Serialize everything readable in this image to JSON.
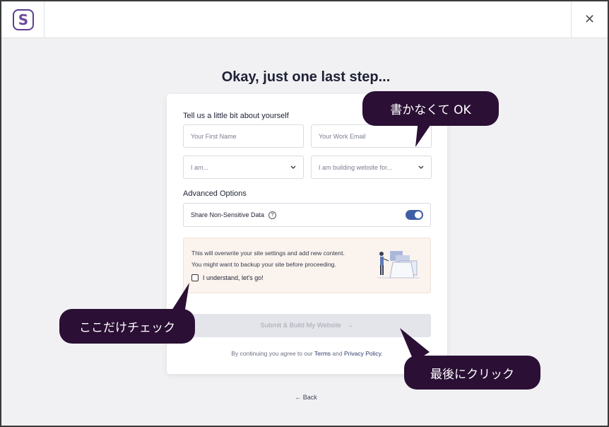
{
  "app": {
    "logo_letter": "S",
    "close_symbol": "✕"
  },
  "page": {
    "heading": "Okay, just one last step..."
  },
  "form": {
    "section_title": "Tell us a little bit about yourself",
    "first_name_placeholder": "Your First Name",
    "email_placeholder": "Your Work Email",
    "role_select": "I am...",
    "purpose_select": "I am building website for...",
    "advanced_title": "Advanced Options",
    "share_label": "Share Non-Sensitive Data",
    "share_help": "?",
    "share_enabled": true
  },
  "notice": {
    "line1": "This will overwrite your site settings and add new content.",
    "line2": "You might want to backup your site before proceeding.",
    "checkbox_label": "I understand, let's go!",
    "checked": false
  },
  "submit": {
    "label": "Submit & Build My Website",
    "arrow": "→"
  },
  "terms": {
    "prefix": "By continuing you agree to our",
    "terms_link": "Terms",
    "and": "and",
    "privacy_link": "Privacy Policy",
    "suffix": "."
  },
  "back": {
    "arrow": "←",
    "label": "Back"
  },
  "annotations": {
    "no_need_to_write": "書かなくて OK",
    "check_only_here": "ここだけチェック",
    "click_last": "最後にクリック"
  },
  "colors": {
    "bubble": "#2b0f35",
    "toggle": "#3e5fa6",
    "logo": "#5b3f8f"
  }
}
